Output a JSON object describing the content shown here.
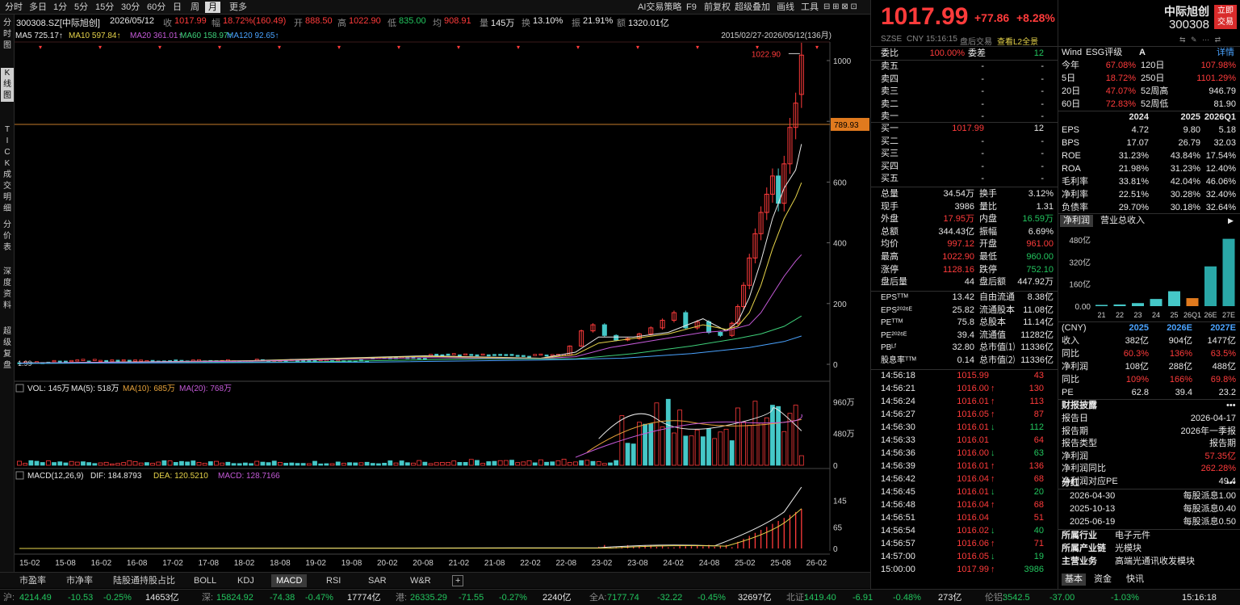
{
  "toolbar": {
    "periods": [
      "分时",
      "多日",
      "1分",
      "5分",
      "15分",
      "30分",
      "60分",
      "日",
      "周",
      "月",
      "更多"
    ],
    "active_period": "月",
    "ai": "AI交易策略",
    "f9": "F9",
    "fq": "前复权",
    "overlay": "超级叠加",
    "draw": "画线",
    "tools": "工具"
  },
  "stock": {
    "code_title": "300308.SZ[中际旭创]",
    "date": "2026/05/12",
    "close_label": "收",
    "close": "1017.99",
    "chg_label": "幅",
    "chg": "18.72%(160.49)",
    "open_label": "开",
    "open": "888.50",
    "high_label": "高",
    "high": "1022.90",
    "low_label": "低",
    "low": "835.00",
    "avg_label": "均",
    "avg": "908.91",
    "vol_label": "量",
    "vol": "145万",
    "turn_label": "换",
    "turn": "13.10%",
    "amp_label": "振",
    "amp": "21.91%",
    "amt_label": "额",
    "amt": "1320.01亿"
  },
  "ma_line": {
    "ma5": "MA5 725.17↑",
    "ma10": "MA10 597.84↑",
    "ma20": "MA20 361.01↑",
    "ma60": "MA60 158.97↑",
    "ma120": "MA120 92.65↑",
    "range": "2015/02/27-2026/05/12(136月)"
  },
  "left_nav": [
    "分时图",
    "K线图",
    "TICK",
    "成交明细",
    "分价表",
    "深度资料",
    "超级复盘"
  ],
  "chart_data": [
    {
      "type": "candlestick",
      "name": "price",
      "y_ticks": [
        "1000",
        "800",
        "600",
        "400",
        "200",
        "0"
      ],
      "ylim": [
        0,
        1050
      ],
      "high_label": "1022.90",
      "current_label": "789.93",
      "current_value": 789.93,
      "x_ticks": [
        "15-02",
        "15-08",
        "16-02",
        "16-08",
        "17-02",
        "17-08",
        "18-02",
        "18-08",
        "19-02",
        "19-08",
        "20-02",
        "20-08",
        "21-02",
        "21-08",
        "22-02",
        "22-08",
        "23-02",
        "23-08",
        "24-02",
        "24-08",
        "25-02",
        "25-08",
        "26-02"
      ],
      "start_low": "1.99",
      "recent": [
        {
          "x": "23-01",
          "o": 30,
          "c": 60
        },
        {
          "x": "23-03",
          "o": 60,
          "c": 110
        },
        {
          "x": "23-05",
          "o": 110,
          "c": 130
        },
        {
          "x": "23-07",
          "o": 130,
          "c": 95
        },
        {
          "x": "23-09",
          "o": 95,
          "c": 80
        },
        {
          "x": "23-11",
          "o": 80,
          "c": 85
        },
        {
          "x": "24-01",
          "o": 85,
          "c": 100
        },
        {
          "x": "24-03",
          "o": 100,
          "c": 120
        },
        {
          "x": "24-05",
          "o": 120,
          "c": 145
        },
        {
          "x": "24-07",
          "o": 145,
          "c": 170
        },
        {
          "x": "24-09",
          "o": 170,
          "c": 120
        },
        {
          "x": "24-11",
          "o": 120,
          "c": 140
        },
        {
          "x": "25-01",
          "o": 140,
          "c": 105
        },
        {
          "x": "25-03",
          "o": 105,
          "c": 95
        },
        {
          "x": "25-05",
          "o": 95,
          "c": 135
        },
        {
          "x": "25-06",
          "o": 135,
          "c": 190
        },
        {
          "x": "25-07",
          "o": 190,
          "c": 260
        },
        {
          "x": "25-08",
          "o": 260,
          "c": 350
        },
        {
          "x": "25-09",
          "o": 350,
          "c": 430
        },
        {
          "x": "25-10",
          "o": 430,
          "c": 500
        },
        {
          "x": "25-11",
          "o": 500,
          "c": 560
        },
        {
          "x": "25-12",
          "o": 560,
          "c": 620
        },
        {
          "x": "26-01",
          "o": 620,
          "c": 530
        },
        {
          "x": "26-02",
          "o": 530,
          "c": 660
        },
        {
          "x": "26-03",
          "o": 660,
          "c": 780
        },
        {
          "x": "26-04",
          "o": 780,
          "c": 860
        },
        {
          "x": "26-05",
          "o": 888.5,
          "c": 1017.99
        }
      ]
    },
    {
      "type": "bar",
      "name": "VOL",
      "title": "VOL: 145万",
      "ma5": "MA(5): 518万",
      "ma10": "MA(10): 685万",
      "ma20": "MA(20): 768万",
      "y_ticks": [
        "960万",
        "480万",
        "0"
      ]
    },
    {
      "type": "line",
      "name": "MACD",
      "title": "MACD(12,26,9)",
      "dif": "DIF: 184.8793",
      "dea": "DEA: 120.5210",
      "macd": "MACD: 128.7166",
      "y_ticks": [
        "145",
        "65",
        "0"
      ]
    }
  ],
  "bottom_tabs": [
    "市盈率",
    "市净率",
    "陆股通持股占比",
    "BOLL",
    "KDJ",
    "MACD",
    "RSI",
    "SAR",
    "W&R"
  ],
  "active_bottom_tab": "MACD",
  "quote": {
    "price": "1017.99",
    "change": "+77.86",
    "pct": "+8.28%",
    "name": "中际旭创",
    "code": "300308",
    "buy_btn1": "立即",
    "buy_btn2": "交易",
    "meta": [
      "SZSE",
      "CNY",
      "15:16:15",
      "盘后交易",
      "查看L2全景"
    ]
  },
  "order_book": {
    "wb_label": "委比",
    "wb": "100.00%",
    "wc_label": "委差",
    "wc": "12",
    "asks": [
      {
        "n": "卖五",
        "p": "-",
        "v": "-"
      },
      {
        "n": "卖四",
        "p": "-",
        "v": "-"
      },
      {
        "n": "卖三",
        "p": "-",
        "v": "-"
      },
      {
        "n": "卖二",
        "p": "-",
        "v": "-"
      },
      {
        "n": "卖一",
        "p": "-",
        "v": "-"
      }
    ],
    "bids": [
      {
        "n": "买一",
        "p": "1017.99",
        "v": "12"
      },
      {
        "n": "买二",
        "p": "-",
        "v": "-"
      },
      {
        "n": "买三",
        "p": "-",
        "v": "-"
      },
      {
        "n": "买四",
        "p": "-",
        "v": "-"
      },
      {
        "n": "买五",
        "p": "-",
        "v": "-"
      }
    ]
  },
  "stats": [
    {
      "l1": "总量",
      "v1": "34.54万",
      "l2": "换手",
      "v2": "3.12%"
    },
    {
      "l1": "现手",
      "v1": "3986",
      "l2": "量比",
      "v2": "1.31"
    },
    {
      "l1": "外盘",
      "v1": "17.95万",
      "l2": "内盘",
      "v2": "16.59万"
    },
    {
      "l1": "总额",
      "v1": "344.43亿",
      "l2": "振幅",
      "v2": "6.69%"
    },
    {
      "l1": "均价",
      "v1": "997.12",
      "l2": "开盘",
      "v2": "961.00"
    },
    {
      "l1": "最高",
      "v1": "1022.90",
      "l2": "最低",
      "v2": "960.00"
    },
    {
      "l1": "涨停",
      "v1": "1128.16",
      "l2": "跌停",
      "v2": "752.10"
    },
    {
      "l1": "盘后量",
      "v1": "44",
      "l2": "盘后额",
      "v2": "447.92万"
    }
  ],
  "stats2": [
    {
      "l1": "EPSᵀᵀᴹ",
      "v1": "13.42",
      "l2": "自由流通",
      "v2": "8.38亿"
    },
    {
      "l1": "EPS²⁰²⁶ᴱ",
      "v1": "25.82",
      "l2": "流通股本",
      "v2": "11.08亿"
    },
    {
      "l1": "PEᵀᵀᴹ",
      "v1": "75.8",
      "l2": "总股本",
      "v2": "11.14亿"
    },
    {
      "l1": "PE²⁰²⁶ᴱ",
      "v1": "39.4",
      "l2": "流通值",
      "v2": "11282亿"
    },
    {
      "l1": "PBᴸᶠ",
      "v1": "32.80",
      "l2": "总市值⑴",
      "v2": "11336亿"
    },
    {
      "l1": "股息率ᵀᵀᴹ",
      "v1": "0.14",
      "l2": "总市值⑵",
      "v2": "11336亿"
    }
  ],
  "ticks": [
    {
      "t": "14:56:18",
      "p": "1015.99",
      "a": "",
      "v": "43",
      "vc": "red"
    },
    {
      "t": "14:56:21",
      "p": "1016.00",
      "a": "↑",
      "v": "130",
      "vc": "red"
    },
    {
      "t": "14:56:24",
      "p": "1016.01",
      "a": "↑",
      "v": "113",
      "vc": "red"
    },
    {
      "t": "14:56:27",
      "p": "1016.05",
      "a": "↑",
      "v": "87",
      "vc": "red"
    },
    {
      "t": "14:56:30",
      "p": "1016.01",
      "a": "↓",
      "v": "112",
      "vc": "green"
    },
    {
      "t": "14:56:33",
      "p": "1016.01",
      "a": "",
      "v": "64",
      "vc": "red"
    },
    {
      "t": "14:56:36",
      "p": "1016.00",
      "a": "↓",
      "v": "63",
      "vc": "green"
    },
    {
      "t": "14:56:39",
      "p": "1016.01",
      "a": "↑",
      "v": "136",
      "vc": "red"
    },
    {
      "t": "14:56:42",
      "p": "1016.04",
      "a": "↑",
      "v": "68",
      "vc": "red"
    },
    {
      "t": "14:56:45",
      "p": "1016.01",
      "a": "↓",
      "v": "20",
      "vc": "green"
    },
    {
      "t": "14:56:48",
      "p": "1016.04",
      "a": "↑",
      "v": "68",
      "vc": "red"
    },
    {
      "t": "14:56:51",
      "p": "1016.04",
      "a": "",
      "v": "51",
      "vc": "red"
    },
    {
      "t": "14:56:54",
      "p": "1016.02",
      "a": "↓",
      "v": "40",
      "vc": "green"
    },
    {
      "t": "14:56:57",
      "p": "1016.06",
      "a": "↑",
      "v": "71",
      "vc": "red"
    },
    {
      "t": "14:57:00",
      "p": "1016.05",
      "a": "↓",
      "v": "19",
      "vc": "green"
    },
    {
      "t": "15:00:00",
      "p": "1017.99",
      "a": "↑",
      "v": "3986",
      "vc": "green"
    }
  ],
  "fin": {
    "wind_label": "Wind",
    "esg_label": "ESG评级",
    "esg": "A",
    "detail": "详情",
    "perf": [
      {
        "l1": "今年",
        "v1": "67.08%",
        "l2": "120日",
        "v2": "107.98%"
      },
      {
        "l1": "5日",
        "v1": "18.72%",
        "l2": "250日",
        "v2": "1101.29%"
      },
      {
        "l1": "20日",
        "v1": "47.07%",
        "l2": "52周高",
        "v2": "946.79"
      },
      {
        "l1": "60日",
        "v1": "72.83%",
        "l2": "52周低",
        "v2": "81.90"
      }
    ],
    "years": [
      "2024",
      "2025",
      "2026Q1"
    ],
    "metrics": [
      {
        "k": "EPS",
        "a": "4.72",
        "b": "9.80",
        "c": "5.18"
      },
      {
        "k": "BPS",
        "a": "17.07",
        "b": "26.79",
        "c": "32.03"
      },
      {
        "k": "ROE",
        "a": "31.23%",
        "b": "43.84%",
        "c": "17.54%"
      },
      {
        "k": "ROA",
        "a": "21.98%",
        "b": "31.23%",
        "c": "12.40%"
      },
      {
        "k": "毛利率",
        "a": "33.81%",
        "b": "42.04%",
        "c": "46.06%"
      },
      {
        "k": "净利率",
        "a": "22.51%",
        "b": "30.28%",
        "c": "32.40%"
      },
      {
        "k": "负债率",
        "a": "29.70%",
        "b": "30.18%",
        "c": "32.64%"
      }
    ],
    "tab1": "净利润",
    "tab2": "营业总收入",
    "mini_chart": {
      "y_ticks": [
        "480亿",
        "320亿",
        "160亿",
        "0.00"
      ],
      "categories": [
        "21",
        "22",
        "23",
        "24",
        "25",
        "26Q1",
        "26E",
        "27E"
      ],
      "values": [
        9,
        12,
        22,
        52,
        108,
        58,
        288,
        488
      ],
      "colors": [
        "#45c8c8",
        "#45c8c8",
        "#45c8c8",
        "#45c8c8",
        "#45c8c8",
        "#e07a1e",
        "#2aa7a7",
        "#2aa7a7"
      ]
    },
    "fc_header": [
      "(CNY)",
      "2025",
      "2026E",
      "2027E"
    ],
    "forecast": [
      {
        "k": "收入",
        "a": "382亿",
        "b": "904亿",
        "c": "1477亿",
        "cls": "wht"
      },
      {
        "k": "同比",
        "a": "60.3%",
        "b": "136%",
        "c": "63.5%",
        "cls": "red"
      },
      {
        "k": "净利润",
        "a": "108亿",
        "b": "288亿",
        "c": "488亿",
        "cls": "wht"
      },
      {
        "k": "同比",
        "a": "109%",
        "b": "166%",
        "c": "69.8%",
        "cls": "red"
      },
      {
        "k": "PE",
        "a": "62.8",
        "b": "39.4",
        "c": "23.2",
        "cls": "wht"
      }
    ],
    "report_title": "财报披露",
    "report": [
      {
        "k": "报告日",
        "v": "2026-04-17",
        "cls": "wht"
      },
      {
        "k": "报告期",
        "v": "2026年一季报",
        "cls": "wht"
      },
      {
        "k": "报告类型",
        "v": "报告期",
        "cls": "wht"
      },
      {
        "k": "净利润",
        "v": "57.35亿",
        "cls": "red"
      },
      {
        "k": "净利润同比",
        "v": "262.28%",
        "cls": "red"
      },
      {
        "k": "净利润对应PE",
        "v": "49.4",
        "cls": "wht"
      }
    ],
    "div_title": "分红",
    "dividends": [
      {
        "d": "2026-04-30",
        "v": "每股派息1.00"
      },
      {
        "d": "2025-10-13",
        "v": "每股派息0.40"
      },
      {
        "d": "2025-06-19",
        "v": "每股派息0.50"
      }
    ],
    "industry": [
      {
        "k": "所属行业",
        "v": "电子元件"
      },
      {
        "k": "所属产业链",
        "v": "光模块"
      },
      {
        "k": "主营业务",
        "v": "高端光通讯收发模块"
      }
    ],
    "tabs": [
      "基本",
      "资金",
      "快讯"
    ]
  },
  "status": [
    {
      "t": "沪:",
      "c": "gry"
    },
    {
      "t": "4214.49",
      "c": "green"
    },
    {
      "t": "-10.53",
      "c": "green"
    },
    {
      "t": "-0.25%",
      "c": "green"
    },
    {
      "t": "14653亿",
      "c": "wht"
    },
    {
      "t": "深:",
      "c": "gry"
    },
    {
      "t": "15824.92",
      "c": "green"
    },
    {
      "t": "-74.38",
      "c": "green"
    },
    {
      "t": "-0.47%",
      "c": "green"
    },
    {
      "t": "17774亿",
      "c": "wht"
    },
    {
      "t": "港:",
      "c": "gry"
    },
    {
      "t": "26335.29",
      "c": "green"
    },
    {
      "t": "-71.55",
      "c": "green"
    },
    {
      "t": "-0.27%",
      "c": "green"
    },
    {
      "t": "2240亿",
      "c": "wht"
    },
    {
      "t": "全A:",
      "c": "gry"
    },
    {
      "t": "7177.74",
      "c": "green"
    },
    {
      "t": "-32.22",
      "c": "green"
    },
    {
      "t": "-0.45%",
      "c": "green"
    },
    {
      "t": "32697亿",
      "c": "wht"
    },
    {
      "t": "北证:",
      "c": "gry"
    },
    {
      "t": "1419.40",
      "c": "green"
    },
    {
      "t": "-6.91",
      "c": "green"
    },
    {
      "t": "-0.48%",
      "c": "green"
    },
    {
      "t": "273亿",
      "c": "wht"
    },
    {
      "t": "伦铝:",
      "c": "gry"
    },
    {
      "t": "3542.5",
      "c": "green"
    },
    {
      "t": "-37.00",
      "c": "green"
    },
    {
      "t": "-1.03%",
      "c": "green"
    },
    {
      "t": "15:16:18",
      "c": "wht"
    }
  ]
}
